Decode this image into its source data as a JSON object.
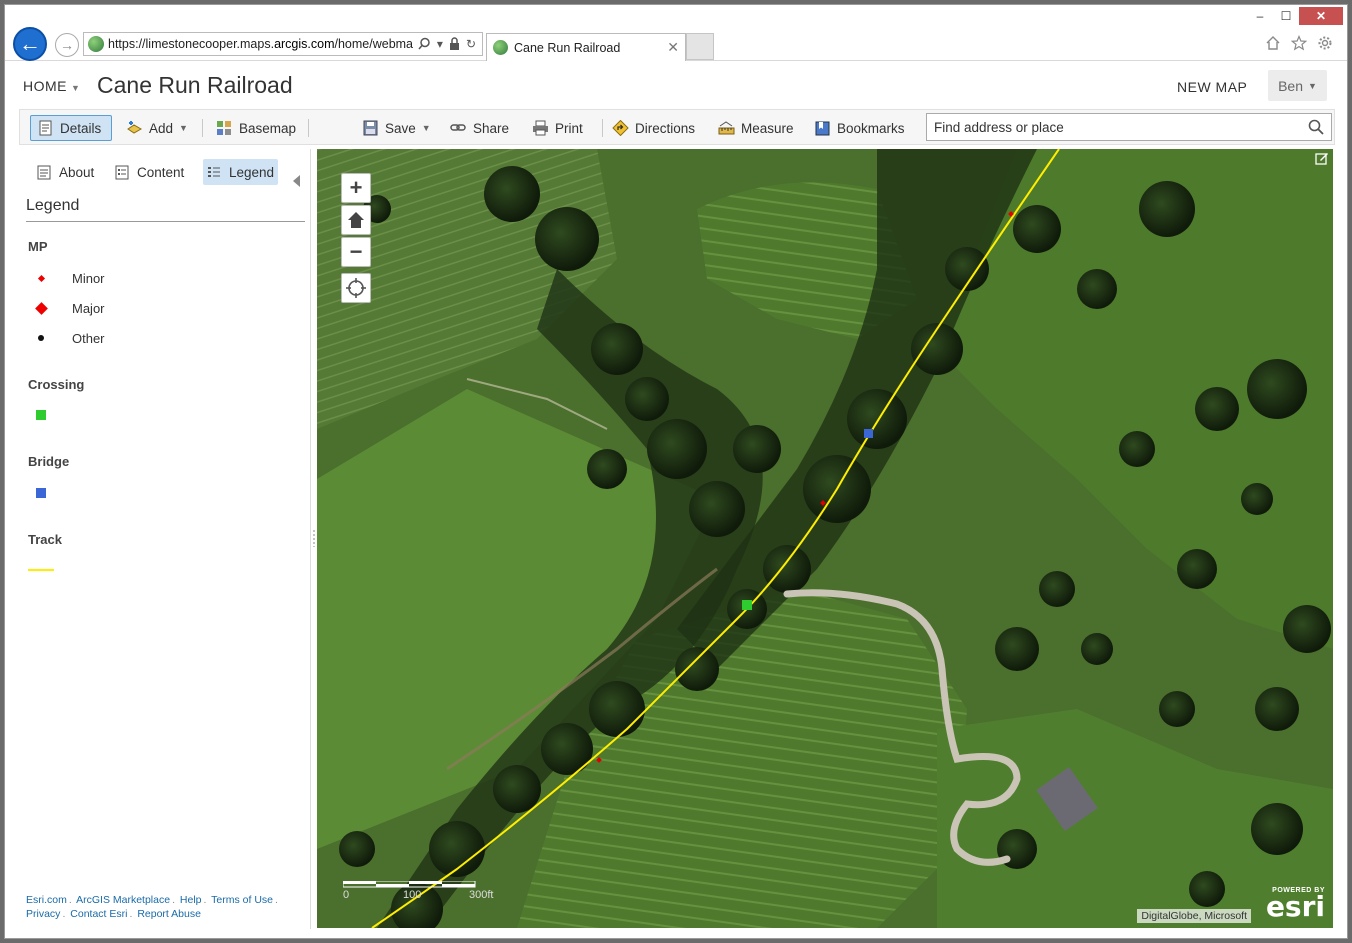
{
  "browser": {
    "url_prefix": "https://limestonecooper.maps.",
    "url_domain": "arcgis.com",
    "url_suffix": "/home/webma",
    "tab_title": "Cane Run Railroad",
    "win_minimize": "‒",
    "win_maximize": "☐",
    "win_close": "✕"
  },
  "header": {
    "home_label": "HOME",
    "map_title": "Cane Run Railroad",
    "new_map_label": "NEW MAP",
    "user_label": "Ben"
  },
  "toolbar": {
    "details": "Details",
    "add": "Add",
    "basemap": "Basemap",
    "save": "Save",
    "share": "Share",
    "print": "Print",
    "directions": "Directions",
    "measure": "Measure",
    "bookmarks": "Bookmarks",
    "search_placeholder": "Find address or place"
  },
  "sidebar": {
    "tabs": [
      {
        "label": "About",
        "icon": "document-icon"
      },
      {
        "label": "Content",
        "icon": "content-icon"
      },
      {
        "label": "Legend",
        "icon": "legend-icon"
      }
    ],
    "active_tab": "Legend",
    "legend_title": "Legend",
    "layers": [
      {
        "title": "MP",
        "items": [
          {
            "label": "Minor",
            "symbol": "small-red-diamond",
            "color": "#e00000"
          },
          {
            "label": "Major",
            "symbol": "red-diamond",
            "color": "#e00000"
          },
          {
            "label": "Other",
            "symbol": "black-dot",
            "color": "#111111"
          }
        ]
      },
      {
        "title": "Crossing",
        "items": [
          {
            "label": "",
            "symbol": "green-square",
            "color": "#2fcc2f"
          }
        ]
      },
      {
        "title": "Bridge",
        "items": [
          {
            "label": "",
            "symbol": "blue-square",
            "color": "#3a66d6"
          }
        ]
      },
      {
        "title": "Track",
        "items": [
          {
            "label": "",
            "symbol": "yellow-line",
            "color": "#ffee00"
          }
        ]
      }
    ],
    "footer_links": [
      "Esri.com",
      "ArcGIS Marketplace",
      "Help",
      "Terms of Use",
      "Privacy",
      "Contact Esri",
      "Report Abuse"
    ]
  },
  "map": {
    "zoom_in": "+",
    "zoom_out": "−",
    "scale_labels": [
      "0",
      "100",
      "300ft"
    ],
    "attribution": "DigitalGlobe, Microsoft",
    "esri_powered": "POWERED BY",
    "esri_name": "esri",
    "colors": {
      "track": "#ffee00",
      "crossing": "#2fcc2f",
      "bridge": "#3a66d6",
      "milepost": "#e00000"
    }
  }
}
